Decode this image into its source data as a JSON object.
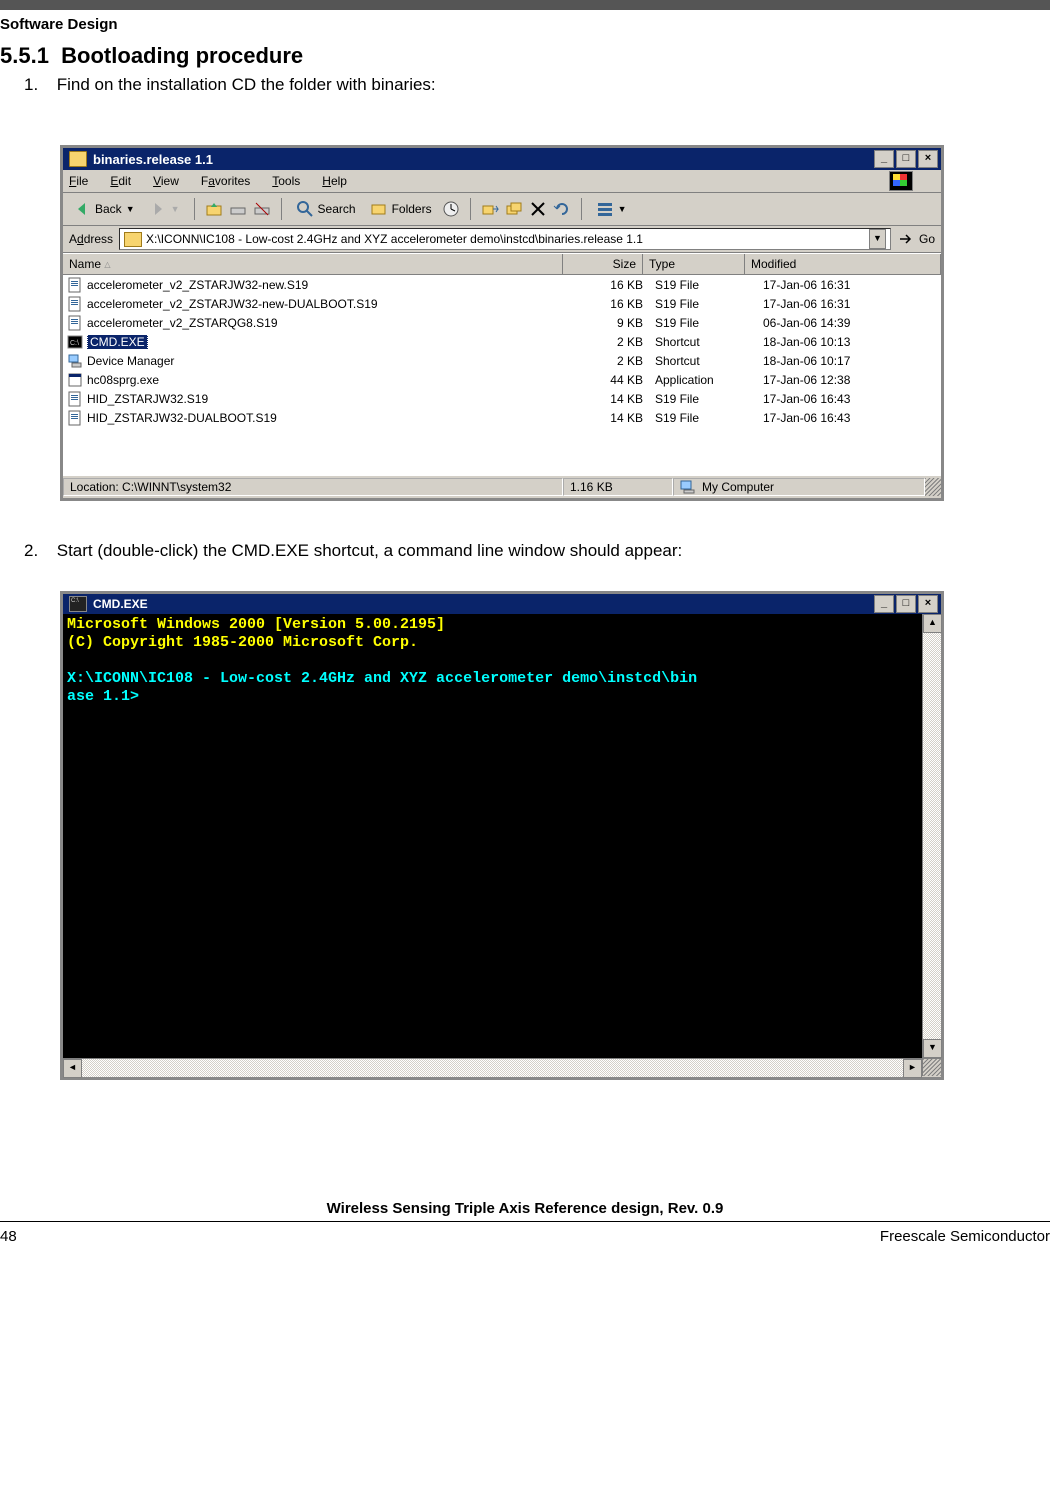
{
  "doc": {
    "section_label": "Software Design",
    "heading_number": "5.5.1",
    "heading_text": "Bootloading procedure",
    "step1_num": "1.",
    "step1_text": "Find on the installation CD the folder with binaries:",
    "step2_num": "2.",
    "step2_text": "Start (double-click) the CMD.EXE shortcut, a command line window should appear:",
    "footer_title": "Wireless Sensing Triple Axis Reference design, Rev. 0.9",
    "page_number": "48",
    "company": "Freescale Semiconductor"
  },
  "explorer": {
    "title": "binaries.release 1.1",
    "menu": {
      "file": "File",
      "edit": "Edit",
      "view": "View",
      "favorites": "Favorites",
      "tools": "Tools",
      "help": "Help"
    },
    "toolbar": {
      "back": "Back",
      "search": "Search",
      "folders": "Folders"
    },
    "address_label": "Address",
    "address_value": "X:\\ICONN\\IC108 - Low-cost 2.4GHz and XYZ accelerometer demo\\instcd\\binaries.release 1.1",
    "go": "Go",
    "columns": {
      "name": "Name",
      "size": "Size",
      "type": "Type",
      "modified": "Modified"
    },
    "files": [
      {
        "icon": "doc",
        "name": "accelerometer_v2_ZSTARJW32-new.S19",
        "size": "16 KB",
        "type": "S19 File",
        "modified": "17-Jan-06 16:31",
        "selected": false
      },
      {
        "icon": "doc",
        "name": "accelerometer_v2_ZSTARJW32-new-DUALBOOT.S19",
        "size": "16 KB",
        "type": "S19 File",
        "modified": "17-Jan-06 16:31",
        "selected": false
      },
      {
        "icon": "doc",
        "name": "accelerometer_v2_ZSTARQG8.S19",
        "size": "9 KB",
        "type": "S19 File",
        "modified": "06-Jan-06 14:39",
        "selected": false
      },
      {
        "icon": "cmd",
        "name": "CMD.EXE",
        "size": "2 KB",
        "type": "Shortcut",
        "modified": "18-Jan-06 10:13",
        "selected": true
      },
      {
        "icon": "dev",
        "name": "Device Manager",
        "size": "2 KB",
        "type": "Shortcut",
        "modified": "18-Jan-06 10:17",
        "selected": false
      },
      {
        "icon": "exe",
        "name": "hc08sprg.exe",
        "size": "44 KB",
        "type": "Application",
        "modified": "17-Jan-06 12:38",
        "selected": false
      },
      {
        "icon": "doc",
        "name": "HID_ZSTARJW32.S19",
        "size": "14 KB",
        "type": "S19 File",
        "modified": "17-Jan-06 16:43",
        "selected": false
      },
      {
        "icon": "doc",
        "name": "HID_ZSTARJW32-DUALBOOT.S19",
        "size": "14 KB",
        "type": "S19 File",
        "modified": "17-Jan-06 16:43",
        "selected": false
      }
    ],
    "status": {
      "location": "Location: C:\\WINNT\\system32",
      "size": "1.16 KB",
      "computer": "My Computer"
    },
    "winbuttons": {
      "min": "_",
      "max": "□",
      "close": "×"
    }
  },
  "console": {
    "title": "CMD.EXE",
    "line1": "Microsoft Windows 2000 [Version 5.00.2195]",
    "line2": "(C) Copyright 1985-2000 Microsoft Corp.",
    "prompt1": "X:\\ICONN\\IC108 - Low-cost 2.4GHz and XYZ accelerometer demo\\instcd\\bin",
    "prompt2": "ase 1.1>",
    "winbuttons": {
      "min": "_",
      "max": "□",
      "close": "×"
    }
  }
}
